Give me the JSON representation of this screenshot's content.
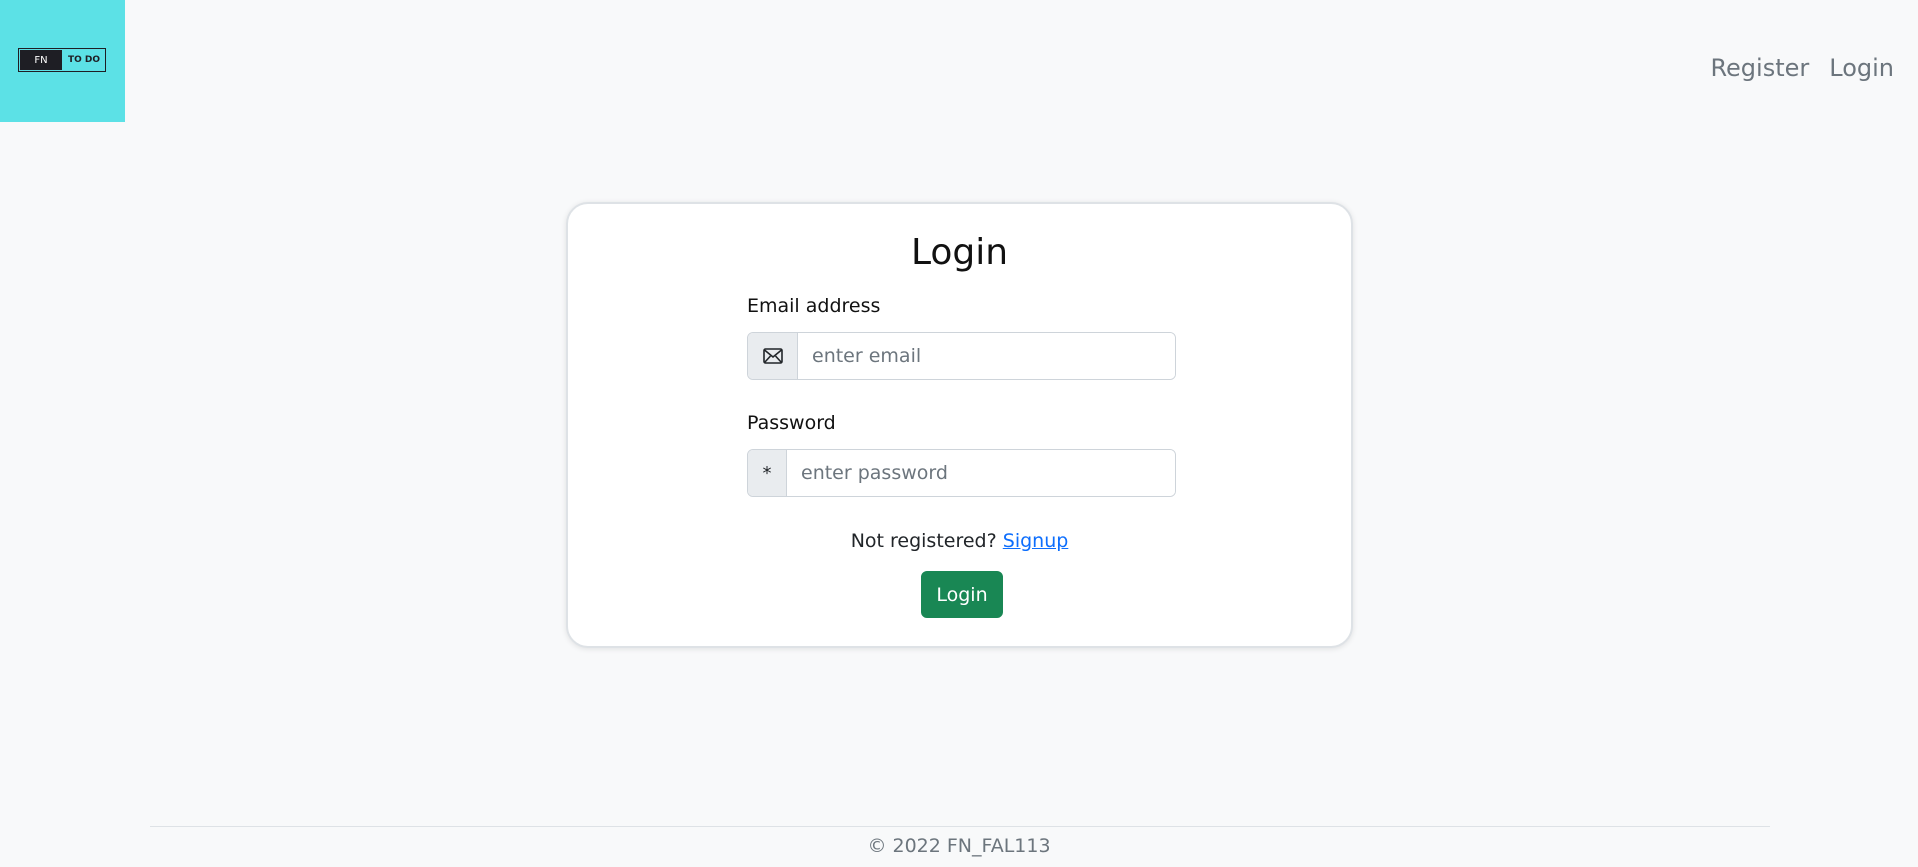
{
  "header": {
    "logo": {
      "left_text": "FN",
      "right_text": "TO DO",
      "bg_color": "#5ce1e6"
    },
    "nav": [
      {
        "label": "Register"
      },
      {
        "label": "Login"
      }
    ]
  },
  "login_card": {
    "title": "Login",
    "email": {
      "label": "Email address",
      "placeholder": "enter email",
      "value": "",
      "icon": "envelope-icon"
    },
    "password": {
      "label": "Password",
      "placeholder": "enter password",
      "value": "",
      "addon_text": "*"
    },
    "signup_prompt": "Not registered?",
    "signup_link": "Signup",
    "submit_label": "Login",
    "submit_color": "#198754"
  },
  "footer": {
    "text": "© 2022 FN_FAL113"
  }
}
